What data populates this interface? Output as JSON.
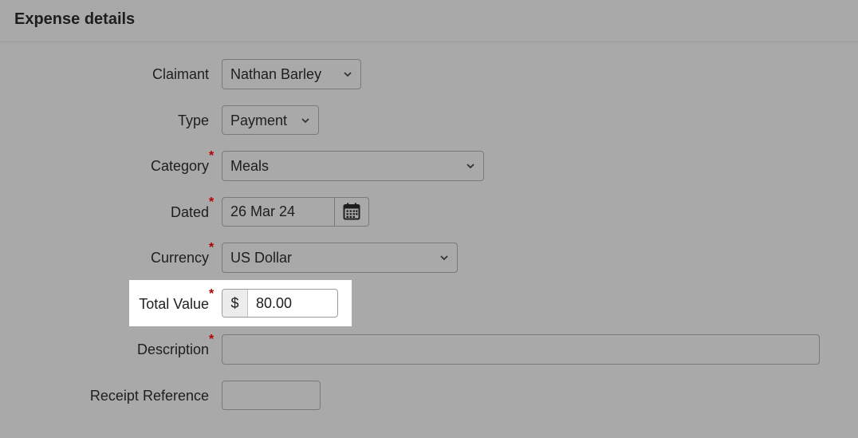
{
  "header": {
    "title": "Expense details"
  },
  "form": {
    "claimant": {
      "label": "Claimant",
      "value": "Nathan Barley",
      "required": false
    },
    "type": {
      "label": "Type",
      "value": "Payment",
      "required": false
    },
    "category": {
      "label": "Category",
      "value": "Meals",
      "required": true
    },
    "dated": {
      "label": "Dated",
      "value": "26 Mar 24",
      "required": true,
      "icon": "calendar-icon"
    },
    "currency": {
      "label": "Currency",
      "value": "US Dollar",
      "required": true
    },
    "total_value": {
      "label": "Total Value",
      "prefix": "$",
      "value": "80.00",
      "required": true
    },
    "description": {
      "label": "Description",
      "value": "",
      "required": true
    },
    "receipt_reference": {
      "label": "Receipt Reference",
      "value": "",
      "required": false
    }
  },
  "required_marker": "*",
  "colors": {
    "background": "#a9a9a9",
    "highlight": "#ffffff",
    "required": "#b10000",
    "text": "#1e1e1e"
  }
}
